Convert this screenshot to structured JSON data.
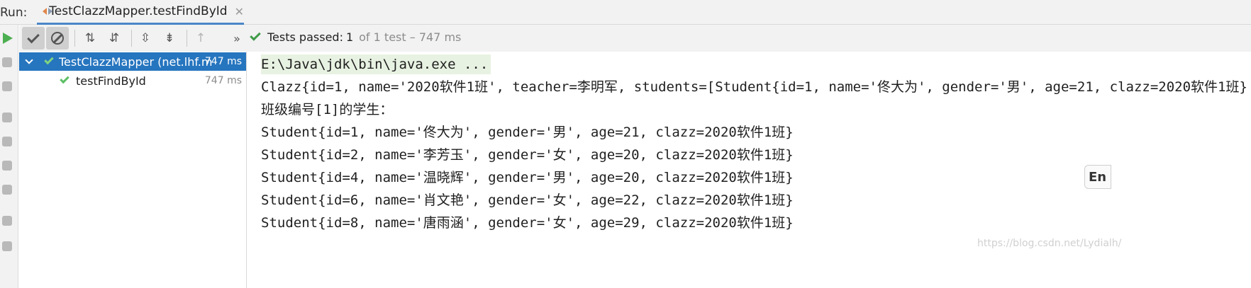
{
  "run_bar": {
    "label": "Run:",
    "tab_title": "TestClazzMapper.testFindById",
    "close_glyph": "✕"
  },
  "toolbar": {
    "status_passed": "Tests passed:",
    "status_count": "1",
    "status_detail": "of 1 test – 747 ms",
    "more_glyph": "»",
    "icons": [
      "show-passed-icon",
      "show-ignored-icon",
      "sort-alpha-icon",
      "sort-duration-icon",
      "expand-all-icon",
      "collapse-all-icon",
      "previous-failed-icon",
      "more-icon"
    ]
  },
  "tree": {
    "root": {
      "name": "TestClazzMapper (net.lhf.m",
      "time": "747 ms"
    },
    "child": {
      "name": "testFindById",
      "time": "747 ms"
    }
  },
  "console": {
    "lines": [
      "E:\\Java\\jdk\\bin\\java.exe ...",
      "Clazz{id=1, name='2020软件1班', teacher=李明军, students=[Student{id=1, name='佟大为', gender='男', age=21, clazz=2020软件1班}",
      "班级编号[1]的学生：",
      "Student{id=1, name='佟大为', gender='男', age=21, clazz=2020软件1班}",
      "Student{id=2, name='李芳玉', gender='女', age=20, clazz=2020软件1班}",
      "Student{id=4, name='温晓辉', gender='男', age=20, clazz=2020软件1班}",
      "Student{id=6, name='肖文艳', gender='女', age=22, clazz=2020软件1班}",
      "Student{id=8, name='唐雨涵', gender='女', age=29, clazz=2020软件1班}"
    ]
  },
  "ime_indicator": "En",
  "watermark": "https://blog.csdn.net/Lydialh/",
  "colors": {
    "pass_green": "#5cbf63",
    "selection_blue": "#2675bf",
    "cmd_highlight": "#e8f2e2"
  }
}
